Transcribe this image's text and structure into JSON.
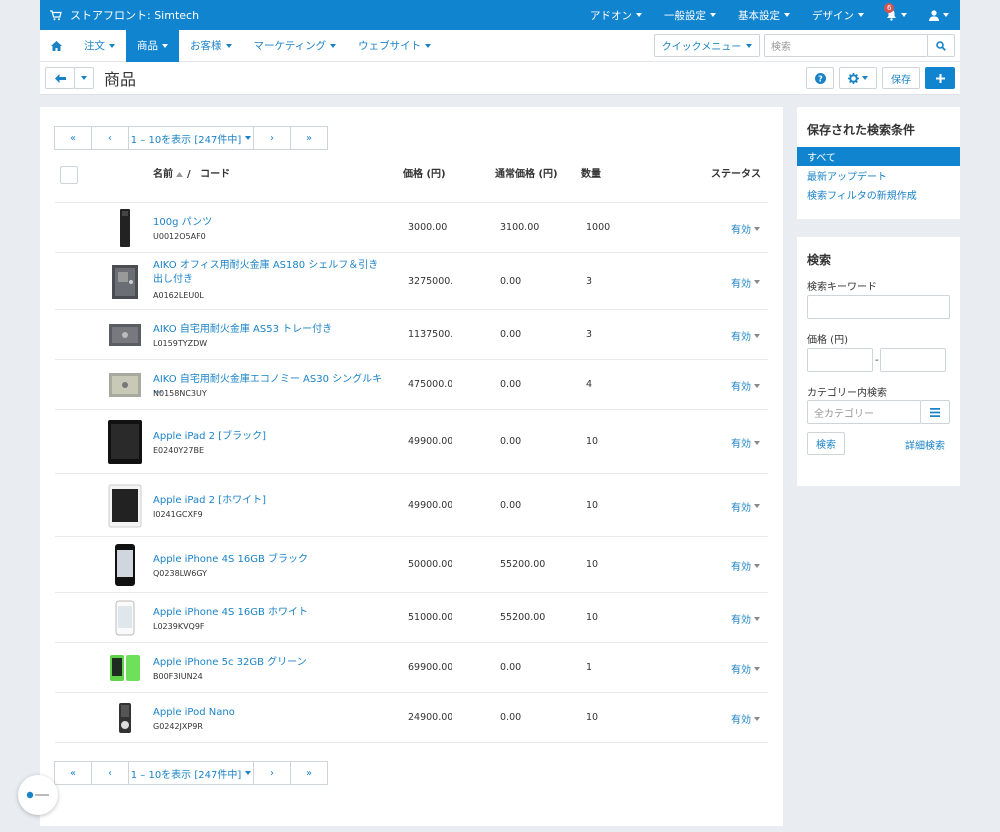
{
  "topbar": {
    "store_label": "ストアフロント: Simtech",
    "menus": [
      "アドオン",
      "一般設定",
      "基本設定",
      "デザイン"
    ],
    "notifications_count": "6"
  },
  "nav": {
    "items": [
      "注文",
      "商品",
      "お客様",
      "マーケティング",
      "ウェブサイト"
    ],
    "active_index": 1,
    "quick_menu": "クイックメニュー",
    "search_placeholder": "検索"
  },
  "titlebar": {
    "title": "商品",
    "save_label": "保存"
  },
  "pager": {
    "first": "«",
    "prev": "‹",
    "range": "1 – 10を表示 [247件中]",
    "next": "›",
    "last": "»"
  },
  "table": {
    "headers": {
      "name": "名前",
      "separator": "/",
      "code": "コード",
      "price": "価格 (円)",
      "list_price": "通常価格 (円)",
      "quantity": "数量",
      "status": "ステータス"
    },
    "rows": [
      {
        "name": "100g パンツ",
        "code": "U0012O5AF0",
        "price": "3000.00",
        "list_price": "3100.00",
        "qty": "1000",
        "status": "有効",
        "thumb": "pants"
      },
      {
        "name": "AIKO オフィス用耐火金庫 AS180 シェルフ＆引き出し付き",
        "code": "A0162LEU0L",
        "price": "3275000.0",
        "list_price": "0.00",
        "qty": "3",
        "status": "有効",
        "thumb": "safe-tall"
      },
      {
        "name": "AIKO 自宅用耐火金庫 AS53 トレー付き",
        "code": "L0159TYZDW",
        "price": "1137500.0",
        "list_price": "0.00",
        "qty": "3",
        "status": "有効",
        "thumb": "safe-small"
      },
      {
        "name": "AIKO 自宅用耐火金庫エコノミー AS30 シングルキー",
        "code": "N0158NC3UY",
        "price": "475000.00",
        "list_price": "0.00",
        "qty": "4",
        "status": "有効",
        "thumb": "safe-beige"
      },
      {
        "name": "Apple iPad 2 [ブラック]",
        "code": "E0240Y27BE",
        "price": "49900.00",
        "list_price": "0.00",
        "qty": "10",
        "status": "有効",
        "thumb": "ipad-black"
      },
      {
        "name": "Apple iPad 2 [ホワイト]",
        "code": "I0241GCXF9",
        "price": "49900.00",
        "list_price": "0.00",
        "qty": "10",
        "status": "有効",
        "thumb": "ipad-white"
      },
      {
        "name": "Apple iPhone 4S 16GB ブラック",
        "code": "Q0238LW6GY",
        "price": "50000.00",
        "list_price": "55200.00",
        "qty": "10",
        "status": "有効",
        "thumb": "iphone-black"
      },
      {
        "name": "Apple iPhone 4S 16GB ホワイト",
        "code": "L0239KVQ9F",
        "price": "51000.00",
        "list_price": "55200.00",
        "qty": "10",
        "status": "有効",
        "thumb": "iphone-white"
      },
      {
        "name": "Apple iPhone 5c 32GB グリーン",
        "code": "B00F3IUN24",
        "price": "69900.00",
        "list_price": "0.00",
        "qty": "1",
        "status": "有効",
        "thumb": "iphone-green"
      },
      {
        "name": "Apple iPod Nano",
        "code": "G0242JXP9R",
        "price": "24900.00",
        "list_price": "0.00",
        "qty": "10",
        "status": "有効",
        "thumb": "ipod"
      }
    ]
  },
  "saved_searches": {
    "title": "保存された検索条件",
    "items": [
      "すべて",
      "最新アップデート",
      "検索フィルタの新規作成"
    ],
    "selected_index": 0
  },
  "search_panel": {
    "title": "検索",
    "keyword_label": "検索キーワード",
    "price_label": "価格 (円)",
    "price_separator": "-",
    "category_label": "カテゴリー内検索",
    "category_placeholder": "全カテゴリー",
    "search_button": "検索",
    "advanced_link": "詳細検索"
  },
  "colors": {
    "accent": "#1184cf",
    "link": "#1a83c6",
    "background": "#e9edf1"
  }
}
